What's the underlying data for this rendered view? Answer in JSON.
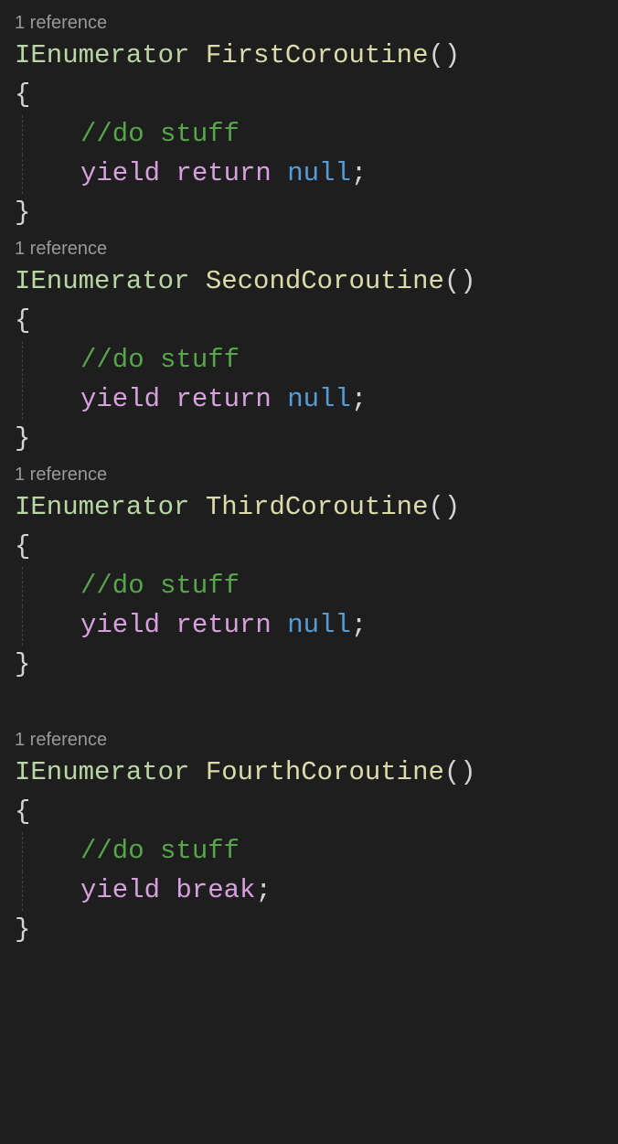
{
  "methods": [
    {
      "codelens": "1 reference",
      "returnType": "IEnumerator",
      "name": "FirstCoroutine",
      "openBrace": "{",
      "comment": "//do stuff",
      "yieldKeyword": "yield",
      "returnKeyword": "return",
      "returnValue": "null",
      "terminator": ";",
      "closeBrace": "}",
      "hasBlankAfter": false
    },
    {
      "codelens": "1 reference",
      "returnType": "IEnumerator",
      "name": "SecondCoroutine",
      "openBrace": "{",
      "comment": "//do stuff",
      "yieldKeyword": "yield",
      "returnKeyword": "return",
      "returnValue": "null",
      "terminator": ";",
      "closeBrace": "}",
      "hasBlankAfter": false
    },
    {
      "codelens": "1 reference",
      "returnType": "IEnumerator",
      "name": "ThirdCoroutine",
      "openBrace": "{",
      "comment": "//do stuff",
      "yieldKeyword": "yield",
      "returnKeyword": "return",
      "returnValue": "null",
      "terminator": ";",
      "closeBrace": "}",
      "hasBlankAfter": true
    },
    {
      "codelens": "1 reference",
      "returnType": "IEnumerator",
      "name": "FourthCoroutine",
      "openBrace": "{",
      "comment": "//do stuff",
      "yieldKeyword": "yield",
      "returnKeyword": "break",
      "returnValue": "",
      "terminator": ";",
      "closeBrace": "}",
      "hasBlankAfter": false
    }
  ],
  "parens": "()"
}
